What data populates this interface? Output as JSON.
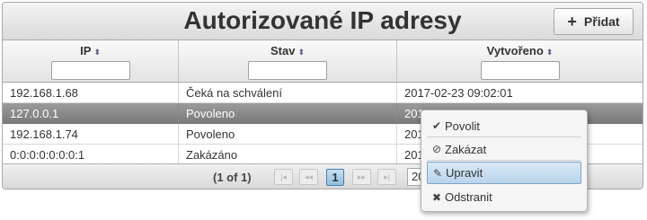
{
  "header": {
    "title": "Autorizované IP adresy",
    "add_label": "Přidat",
    "add_icon": "plus-icon"
  },
  "columns": [
    {
      "label": "IP",
      "sort_icon": "sort-icon"
    },
    {
      "label": "Stav",
      "sort_icon": "sort-icon"
    },
    {
      "label": "Vytvořeno",
      "sort_icon": "sort-icon"
    }
  ],
  "rows": [
    {
      "ip": "192.168.1.68",
      "status": "Čeká na schválení",
      "created": "2017-02-23 09:02:01"
    },
    {
      "ip": "127.0.0.1",
      "status": "Povoleno",
      "created": "2017-02-23 09:14:00"
    },
    {
      "ip": "192.168.1.74",
      "status": "Povoleno",
      "created": "2017-02-23 09:12:45"
    },
    {
      "ip": "0:0:0:0:0:0:0:1",
      "status": "Zakázáno",
      "created": "2017-02-23 08:58:11"
    }
  ],
  "selected_row": 1,
  "paginator": {
    "text": "(1 of 1)",
    "current_page": "1",
    "rows_per_page": "20"
  },
  "context_menu": [
    {
      "label": "Povolit",
      "icon": "check-icon"
    },
    {
      "label": "Zakázat",
      "icon": "ban-icon"
    },
    {
      "label": "Upravit",
      "icon": "edit-icon"
    },
    {
      "label": "Odstranit",
      "icon": "close-icon"
    }
  ],
  "context_menu_hovered": 2
}
